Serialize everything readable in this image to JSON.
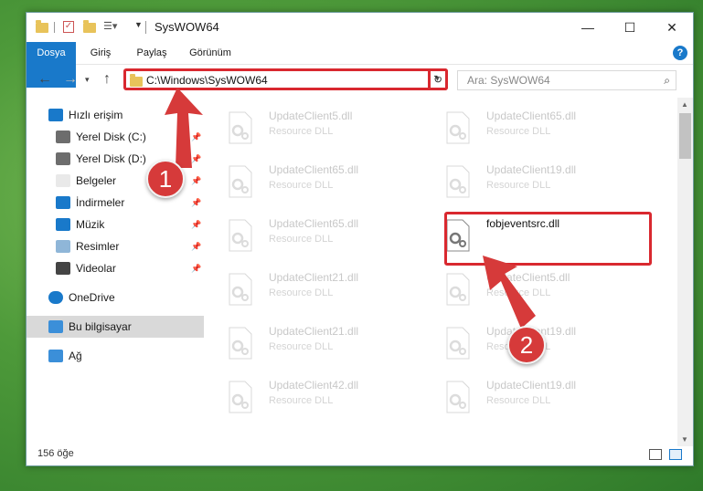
{
  "window": {
    "title": "SysWOW64",
    "controls": {
      "minimize": "—",
      "maximize": "☐",
      "close": "✕"
    }
  },
  "ribbon": {
    "tabs": [
      "Dosya",
      "Giriş",
      "Paylaş",
      "Görünüm"
    ],
    "help": "?"
  },
  "navigation": {
    "address": "C:\\Windows\\SysWOW64",
    "search_placeholder": "Ara: SysWOW64"
  },
  "sidebar": {
    "items": [
      {
        "label": "Hızlı erişim",
        "icon": "star-icon",
        "pinned": false
      },
      {
        "label": "Yerel Disk (C:)",
        "icon": "drive-icon",
        "pinned": true
      },
      {
        "label": "Yerel Disk (D:)",
        "icon": "drive-icon",
        "pinned": true
      },
      {
        "label": "Belgeler",
        "icon": "documents-icon",
        "pinned": true
      },
      {
        "label": "İndirmeler",
        "icon": "download-icon",
        "pinned": true
      },
      {
        "label": "Müzik",
        "icon": "music-icon",
        "pinned": true
      },
      {
        "label": "Resimler",
        "icon": "pictures-icon",
        "pinned": true
      },
      {
        "label": "Videolar",
        "icon": "videos-icon",
        "pinned": true
      },
      {
        "label": "OneDrive",
        "icon": "cloud-icon",
        "pinned": false
      },
      {
        "label": "Bu bilgisayar",
        "icon": "computer-icon",
        "pinned": false,
        "selected": true
      },
      {
        "label": "Ağ",
        "icon": "network-icon",
        "pinned": false
      }
    ]
  },
  "files": [
    {
      "name": "UpdateClient5.dll",
      "type": "Resource DLL"
    },
    {
      "name": "UpdateClient65.dll",
      "type": "Resource DLL"
    },
    {
      "name": "UpdateClient65.dll",
      "type": "Resource DLL"
    },
    {
      "name": "UpdateClient19.dll",
      "type": "Resource DLL"
    },
    {
      "name": "UpdateClient65.dll",
      "type": "Resource DLL"
    },
    {
      "name": "fobjeventsrc.dll",
      "type": "",
      "highlighted": true
    },
    {
      "name": "UpdateClient21.dll",
      "type": "Resource DLL"
    },
    {
      "name": "UpdateClient5.dll",
      "type": "Resource DLL"
    },
    {
      "name": "UpdateClient21.dll",
      "type": "Resource DLL"
    },
    {
      "name": "UpdateClient19.dll",
      "type": "Resource DLL"
    },
    {
      "name": "UpdateClient42.dll",
      "type": "Resource DLL"
    },
    {
      "name": "UpdateClient19.dll",
      "type": "Resource DLL"
    }
  ],
  "status": {
    "count": "156 öğe"
  },
  "annotations": {
    "step1": "1",
    "step2": "2"
  },
  "colors": {
    "accent": "#1979ca",
    "highlight": "#d9282f"
  }
}
